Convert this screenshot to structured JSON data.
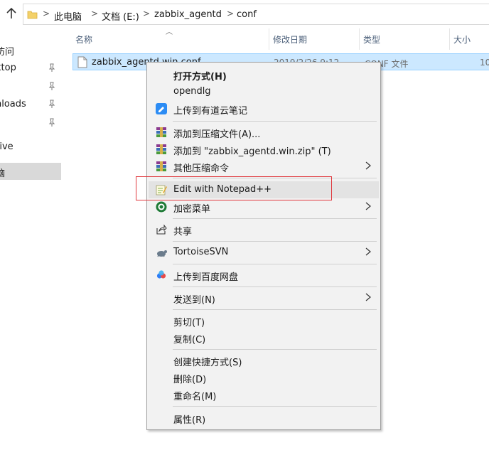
{
  "address": {
    "crumbs": [
      "此电脑",
      "文档 (E:)",
      "zabbix_agentd",
      "conf"
    ],
    "separator": ">"
  },
  "nav": {
    "items": [
      {
        "label": "访问"
      },
      {
        "label": "ktop"
      },
      {
        "label": "nloads"
      },
      {
        "label": ""
      },
      {
        "label": "rive"
      },
      {
        "label": "脑"
      }
    ]
  },
  "columns": {
    "name": "名称",
    "modified": "修改日期",
    "type": "类型",
    "size": "大小"
  },
  "file": {
    "name": "zabbix_agentd.win.conf",
    "modified": "2019/2/26 9:12",
    "type": "CONF 文件",
    "size": "10"
  },
  "menu": {
    "open_with": "打开方式(H)",
    "opendlg": "opendlg",
    "youdao": "上传到有道云笔记",
    "add_archive": "添加到压缩文件(A)...",
    "add_zip": "添加到 \"zabbix_agentd.win.zip\" (T)",
    "other_compress": "其他压缩命令",
    "notepadpp": "Edit with Notepad++",
    "encrypt": "加密菜单",
    "share": "共享",
    "svn": "TortoiseSVN",
    "baidu": "上传到百度网盘",
    "send_to": "发送到(N)",
    "cut": "剪切(T)",
    "copy": "复制(C)",
    "shortcut": "创建快捷方式(S)",
    "delete": "删除(D)",
    "rename": "重命名(M)",
    "properties": "属性(R)"
  },
  "colors": {
    "selection": "#cce8ff",
    "highlight_box": "#e0393e",
    "menu_bg": "#f2f2f2"
  }
}
